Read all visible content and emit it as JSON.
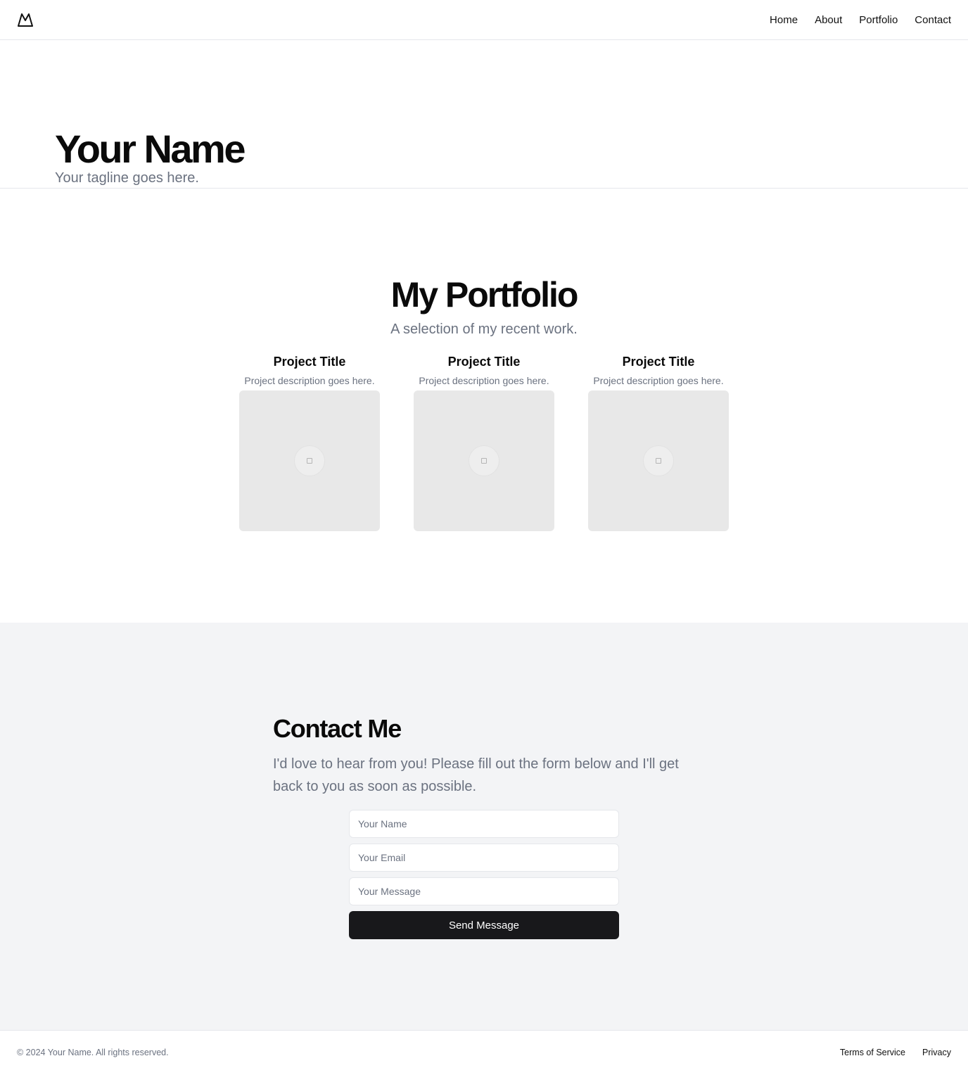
{
  "header": {
    "logo_icon": "mountain-icon",
    "nav": [
      {
        "label": "Home"
      },
      {
        "label": "About"
      },
      {
        "label": "Portfolio"
      },
      {
        "label": "Contact"
      }
    ]
  },
  "hero": {
    "title": "Your Name",
    "tagline": "Your tagline goes here."
  },
  "portfolio": {
    "title": "My Portfolio",
    "subtitle": "A selection of my recent work.",
    "projects": [
      {
        "title": "Project Title",
        "description": "Project description goes here.",
        "image_icon": "image-placeholder-icon"
      },
      {
        "title": "Project Title",
        "description": "Project description goes here.",
        "image_icon": "image-placeholder-icon"
      },
      {
        "title": "Project Title",
        "description": "Project description goes here.",
        "image_icon": "image-placeholder-icon"
      }
    ]
  },
  "contact": {
    "title": "Contact Me",
    "text": "I'd love to hear from you! Please fill out the form below and I'll get back to you as soon as possible.",
    "name_placeholder": "Your Name",
    "email_placeholder": "Your Email",
    "message_placeholder": "Your Message",
    "submit_label": "Send Message"
  },
  "footer": {
    "copyright": "© 2024 Your Name. All rights reserved.",
    "links": [
      {
        "label": "Terms of Service"
      },
      {
        "label": "Privacy"
      }
    ]
  },
  "colors": {
    "accent_dark": "#18181b",
    "muted_text": "#6b7280",
    "contact_bg": "#f3f4f6",
    "placeholder_bg": "#e8e8e8"
  }
}
